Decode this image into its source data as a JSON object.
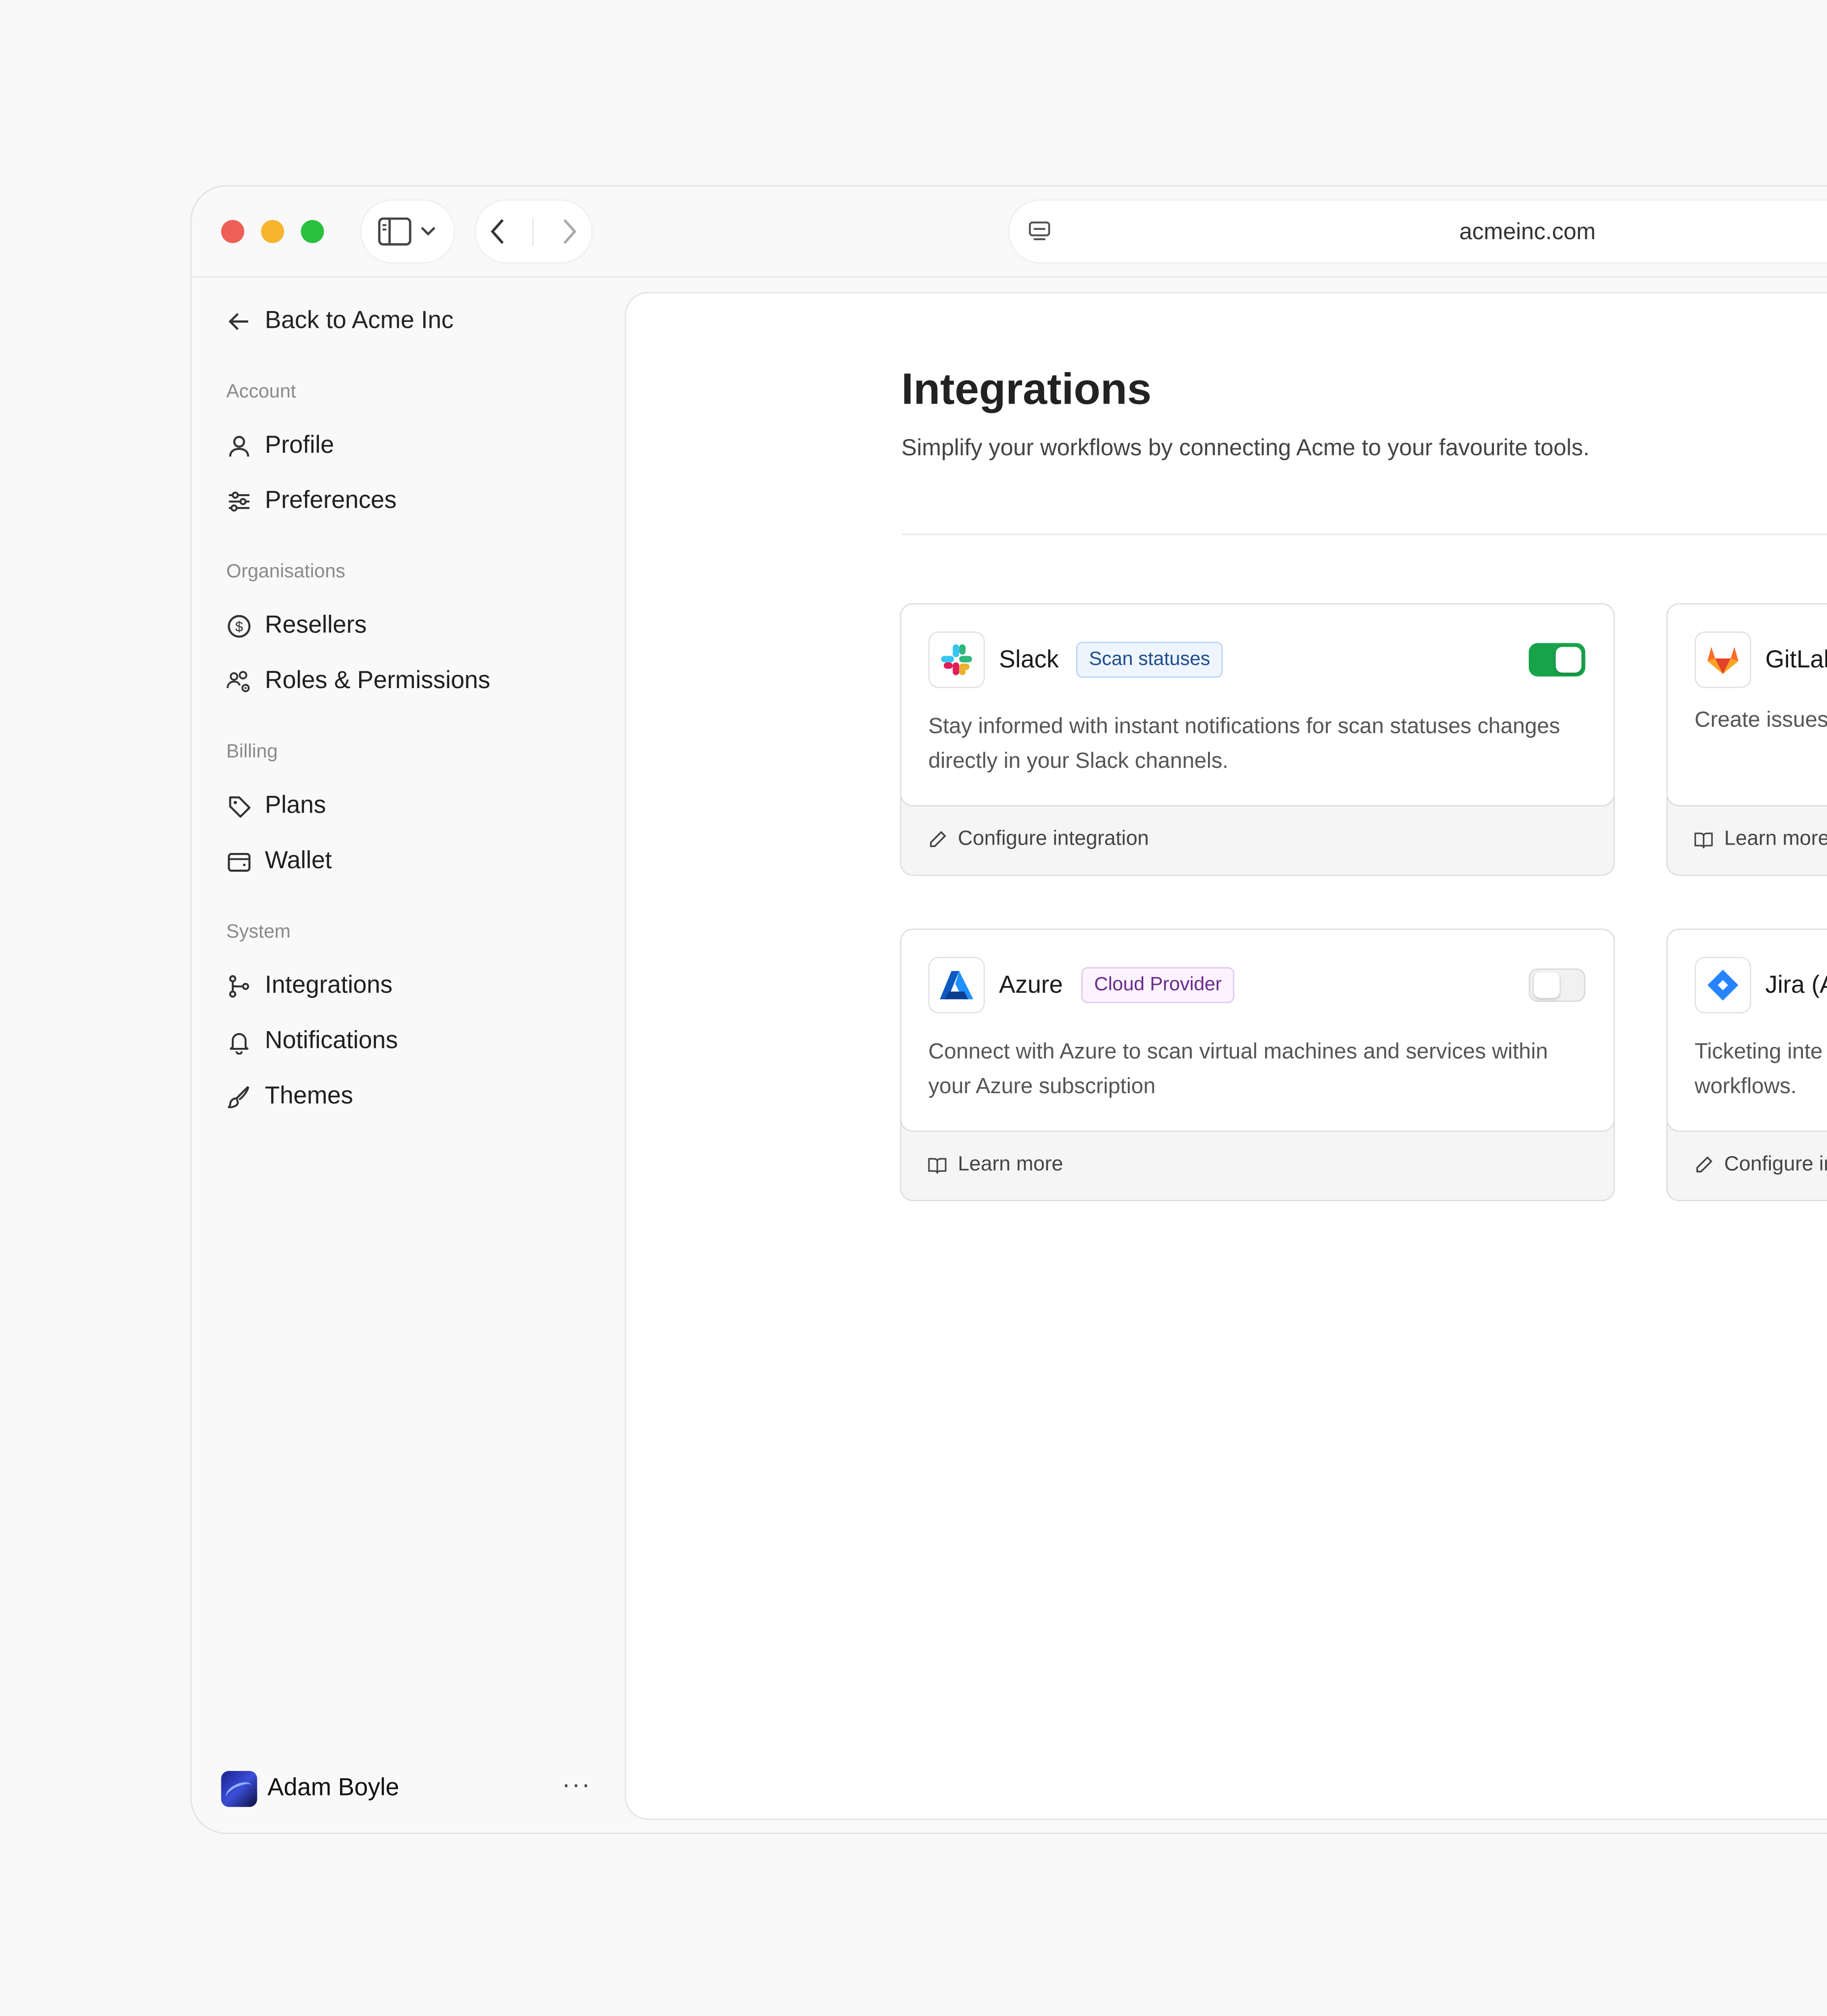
{
  "browser": {
    "url": "acmeinc.com"
  },
  "sidebar": {
    "back_label": "Back to Acme Inc",
    "sections": [
      {
        "label": "Account",
        "items": [
          {
            "label": "Profile",
            "icon": "user-icon"
          },
          {
            "label": "Preferences",
            "icon": "sliders-icon"
          }
        ]
      },
      {
        "label": "Organisations",
        "items": [
          {
            "label": "Resellers",
            "icon": "dollar-circle-icon"
          },
          {
            "label": "Roles & Permissions",
            "icon": "users-gear-icon"
          }
        ]
      },
      {
        "label": "Billing",
        "items": [
          {
            "label": "Plans",
            "icon": "tag-icon"
          },
          {
            "label": "Wallet",
            "icon": "wallet-icon"
          }
        ]
      },
      {
        "label": "System",
        "items": [
          {
            "label": "Integrations",
            "icon": "git-branch-icon"
          },
          {
            "label": "Notifications",
            "icon": "bell-icon"
          },
          {
            "label": "Themes",
            "icon": "brush-icon"
          }
        ]
      }
    ],
    "user": {
      "name": "Adam Boyle",
      "more": "···"
    }
  },
  "main": {
    "title": "Integrations",
    "subtitle": "Simplify your workflows by connecting Acme to your favourite tools.",
    "cards": [
      {
        "name": "Slack",
        "tag": "Scan statuses",
        "enabled": true,
        "description": "Stay informed with instant notifications for scan statuses changes directly in your Slack channels.",
        "action": "Configure integration",
        "action_icon": "pencil-icon"
      },
      {
        "name": "GitLab",
        "description": "Create issues",
        "action": "Learn more",
        "action_icon": "book-icon"
      },
      {
        "name": "Azure",
        "tag": "Cloud Provider",
        "enabled": false,
        "description": "Connect with Azure to scan virtual machines and services within your Azure subscription",
        "action": "Learn more",
        "action_icon": "book-icon"
      },
      {
        "name": "Jira (A",
        "description": "Ticketing inte workflows.",
        "action": "Configure in",
        "action_icon": "pencil-icon"
      }
    ]
  },
  "colors": {
    "toggle_on": "#16a34a",
    "tag_blue": "#1e4d8c",
    "tag_purple": "#6a2a8c"
  }
}
